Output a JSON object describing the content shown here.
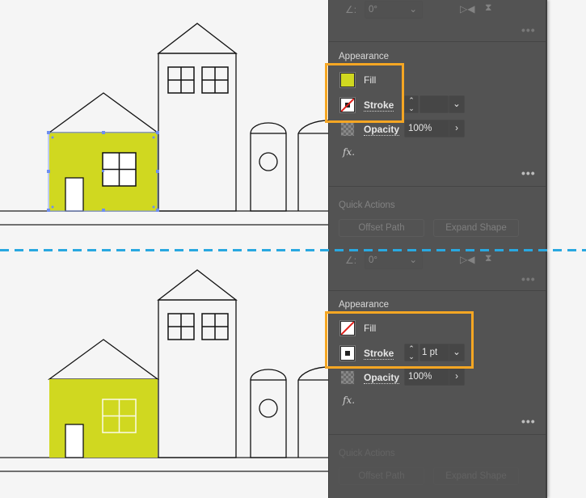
{
  "colors": {
    "canvas_bg": "#f5f5f5",
    "panel_bg": "#535353",
    "house_fill": "#d0d820",
    "highlight": "#f5a623",
    "divider_dash": "#29a8e0",
    "none_slash": "#e0201b"
  },
  "top": {
    "transform": {
      "angle_icon": "angle-icon",
      "angle_value": "0°",
      "flip_horizontal_icon": "flip-horizontal-icon",
      "flip_vertical_icon": "flip-vertical-icon",
      "more_label": "•••"
    },
    "appearance": {
      "title": "Appearance",
      "fill_label": "Fill",
      "fill_state": "color",
      "stroke_label": "Stroke",
      "stroke_state": "none",
      "stroke_weight": "",
      "opacity_label": "Opacity",
      "opacity_value": "100%",
      "fx_label": "fx.",
      "more_label": "•••"
    },
    "quick_actions": {
      "title": "Quick Actions",
      "buttons": [
        "Offset Path",
        "Expand Shape"
      ]
    }
  },
  "bottom": {
    "transform": {
      "angle_value": "0°",
      "more_label": "•••"
    },
    "appearance": {
      "title": "Appearance",
      "fill_label": "Fill",
      "fill_state": "none",
      "stroke_label": "Stroke",
      "stroke_state": "color",
      "stroke_weight": "1 pt",
      "opacity_label": "Opacity",
      "opacity_value": "100%",
      "fx_label": "fx.",
      "more_label": "•••"
    },
    "quick_actions": {
      "title": "Quick Actions",
      "buttons": [
        "Offset Path",
        "Expand Shape"
      ]
    }
  }
}
